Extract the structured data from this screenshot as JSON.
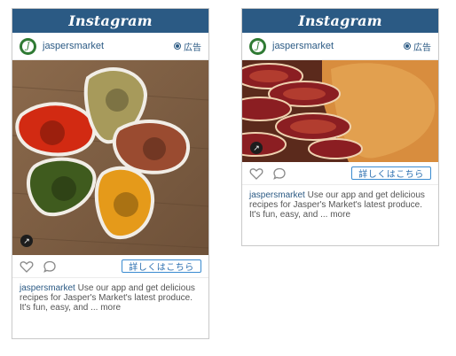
{
  "cards": [
    {
      "brand": "Instagram",
      "account": "jaspersmarket",
      "sponsored_label": "広告",
      "cta_label": "詳しくはこちら",
      "caption_user": "jaspersmarket",
      "caption_text": "Use our app and get delicious recipes for Jasper's Market's latest produce. It's fun, easy, and ...",
      "more_label": "more",
      "image": "spices-in-bowls"
    },
    {
      "brand": "Instagram",
      "account": "jaspersmarket",
      "sponsored_label": "広告",
      "cta_label": "詳しくはこちら",
      "caption_user": "jaspersmarket",
      "caption_text": "Use our app and get delicious recipes for Jasper's Market's latest produce. It's fun, easy, and ...",
      "more_label": "more",
      "image": "fig-tart"
    }
  ],
  "icons": [
    "heart-icon",
    "comment-icon",
    "expand-icon",
    "info-icon"
  ]
}
